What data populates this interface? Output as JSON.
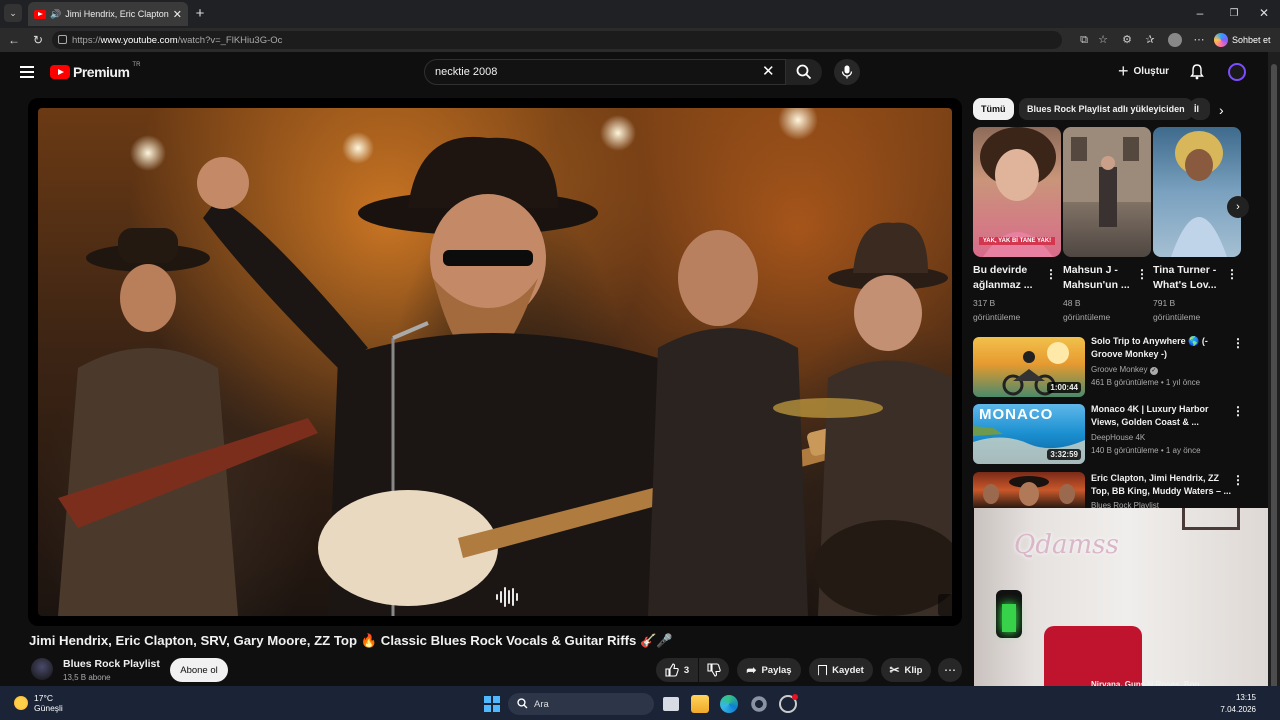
{
  "browser": {
    "tab_title": "Jimi Hendrix, Eric Clapton, SR",
    "url_prefix": "https://",
    "url_domain": "www.youtube.com",
    "url_path": "/watch?v=_FlKHiu3G-Oc",
    "chat_label": "Sohbet et"
  },
  "header": {
    "logo_text": "Premium",
    "logo_region": "TR",
    "search_value": "necktie 2008",
    "create_label": "Oluştur"
  },
  "video": {
    "title": "Jimi Hendrix, Eric Clapton, SRV, Gary Moore, ZZ Top 🔥 Classic Blues Rock Vocals & Guitar Riffs 🎸🎤",
    "channel": "Blues Rock Playlist",
    "subscribers": "13,5 B abone",
    "subscribe_label": "Abone ol",
    "likes": "3",
    "share_label": "Paylaş",
    "save_label": "Kaydet",
    "clip_label": "Klip"
  },
  "chips": [
    "Tümü",
    "Blues Rock Playlist adlı yükleyiciden",
    "İl"
  ],
  "shorts": [
    {
      "title1": "Bu devirde",
      "title2": "ağlanmaz ...",
      "views": "317 B",
      "views_label": "görüntüleme",
      "caption": "YAK, YAK Bİ TANE YAK!"
    },
    {
      "title1": "Mahsun J -",
      "title2": "Mahsun'un ...",
      "views": "48 B",
      "views_label": "görüntüleme"
    },
    {
      "title1": "Tina Turner -",
      "title2": "What's Lov...",
      "views": "791 B",
      "views_label": "görüntüleme"
    }
  ],
  "related": [
    {
      "title": "Solo Trip to Anywhere 🌎 (- Groove Monkey -)",
      "channel": "Groove Monkey",
      "meta": "461 B görüntüleme • 1 yıl önce",
      "duration": "1:00:44"
    },
    {
      "title": "Monaco 4K | Luxury Harbor Views, Golden Coast & ...",
      "channel": "DeepHouse 4K",
      "meta": "140 B görüntüleme • 1 ay önce",
      "duration": "3:32:59",
      "thumb_text": "MONACO"
    },
    {
      "title": "Eric Clapton, Jimi Hendrix, ZZ Top, BB King, Muddy Waters – ...",
      "channel": "Blues Rock Playlist"
    }
  ],
  "bottom_partial": "Nirvana, Guns N Roses, Bon...",
  "webcam": {
    "neon_text": "Qdamss"
  },
  "taskbar": {
    "temp": "17°C",
    "weather": "Güneşli",
    "search_placeholder": "Ara",
    "time": "13:15",
    "date": "7.04.2026"
  },
  "colors": {
    "yt_red": "#ff0000",
    "bg": "#0f0f0f",
    "taskbar": "#1a2436",
    "win_blue": "#4fb8ff"
  }
}
